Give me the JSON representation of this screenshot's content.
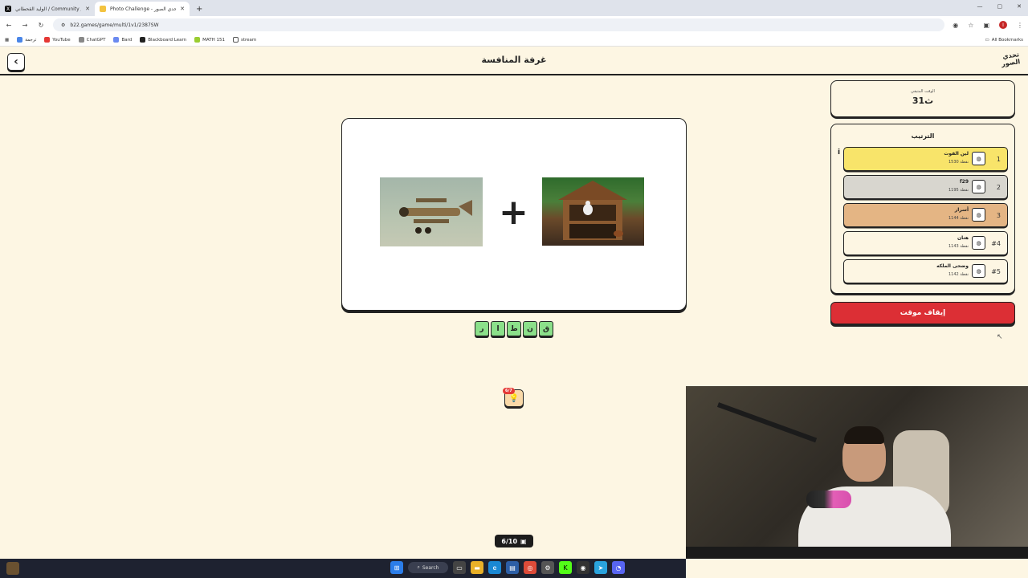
{
  "browser": {
    "tabs": [
      {
        "title": "الوليد القحطاني / Community / X",
        "icon": "x-logo-icon"
      },
      {
        "title": "Photo Challenge - تحدي الصور",
        "icon": "photo-challenge-icon"
      }
    ],
    "url": "b22.games/game/multi/1v1/2387SW",
    "bookmarks": [
      "ترجمة",
      "YouTube",
      "ChatGPT",
      "Bard",
      "Blackboard Learn",
      "MATH 151",
      "stream"
    ],
    "all_bookmarks": "All Bookmarks",
    "profile_initial": "I"
  },
  "header": {
    "title": "غرفة المنافسة",
    "logo_text": "تحدي الصور"
  },
  "timer": {
    "label": "الوقت المتبقي",
    "value": "31ث"
  },
  "ranking": {
    "title": "الترتيب",
    "players": [
      {
        "pos": "1",
        "name": "لين الفوت",
        "score": "1530 نقطة",
        "color": "#f8e46a"
      },
      {
        "pos": "2",
        "name": "f29",
        "score": "1195 نقطة",
        "color": "#d8d6cf"
      },
      {
        "pos": "3",
        "name": "أسرار",
        "score": "1144 نقطة",
        "color": "#e4b584"
      },
      {
        "pos": "#4",
        "name": "هتان",
        "score": "1143 نقطة",
        "color": "#fdf6e3"
      },
      {
        "pos": "#5",
        "name": "وضحى الملكه",
        "score": "1142 نقطة",
        "color": "#fdf6e3"
      }
    ]
  },
  "stop_button": "إيقاف موقت",
  "puzzle": {
    "left_image": "biplane-photo",
    "right_image": "chicken-coop-photo",
    "operator": "+"
  },
  "answer_letters": [
    "ر",
    "ا",
    "ط",
    "ن",
    "ق"
  ],
  "hint": {
    "badge": "6/7",
    "icon": "lightbulb-icon"
  },
  "progress": {
    "text": "6/10"
  },
  "taskbar": {
    "search_label": "Search"
  }
}
